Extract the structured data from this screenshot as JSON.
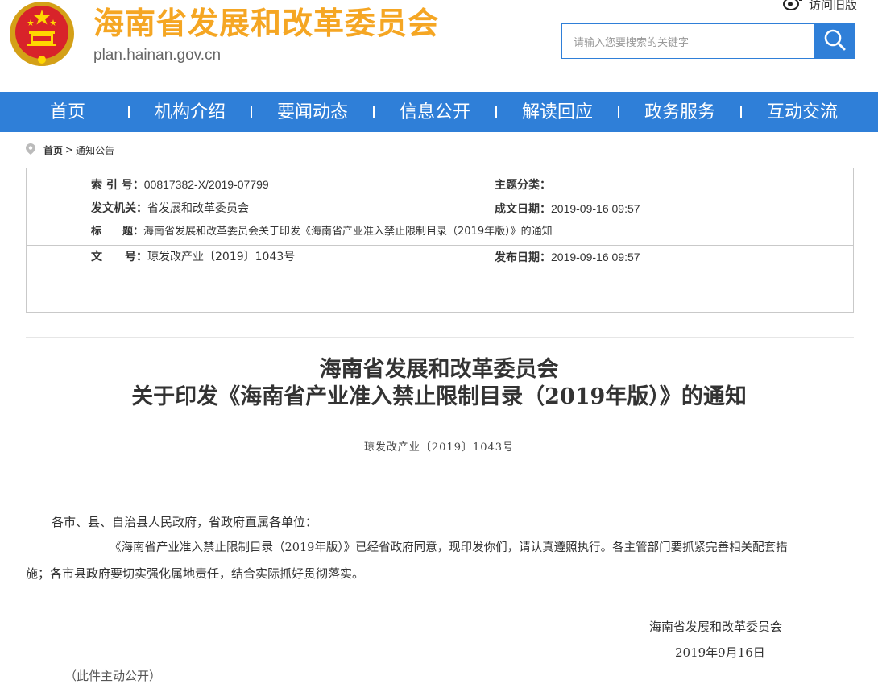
{
  "header": {
    "site_title": "海南省发展和改革委员会",
    "site_url": "plan.hainan.gov.cn",
    "old_version_label": "访问旧版",
    "search_placeholder": "请输入您要搜索的关键字"
  },
  "nav": {
    "items": [
      {
        "label": "首页"
      },
      {
        "label": "机构介绍"
      },
      {
        "label": "要闻动态"
      },
      {
        "label": "信息公开"
      },
      {
        "label": "解读回应"
      },
      {
        "label": "政务服务"
      },
      {
        "label": "互动交流"
      }
    ]
  },
  "breadcrumb": {
    "home": "首页",
    "separator": ">",
    "current": "通知公告"
  },
  "info": {
    "index_no_label": "索 引 号：",
    "index_no": "00817382-X/2019-07799",
    "topic_label": "主题分类：",
    "topic": "",
    "issuer_label": "发文机关：",
    "issuer": "省发展和改革委员会",
    "created_label": "成文日期：",
    "created": "2019-09-16 09:57",
    "title_label": "标　　题：",
    "title": "海南省发展和改革委员会关于印发《海南省产业准入禁止限制目录（2019年版）》的通知",
    "doc_no_label": "文　　号：",
    "doc_no": "琼发改产业〔2019〕1043号",
    "published_label": "发布日期：",
    "published": "2019-09-16 09:57"
  },
  "article": {
    "title_line1": "海南省发展和改革委员会",
    "title_line2": "关于印发《海南省产业准入禁止限制目录（2019年版）》的通知",
    "doc_no": "琼发改产业〔2019〕1043号",
    "salutation": "各市、县、自治县人民政府，省政府直属各单位：",
    "body_line1": "《海南省产业准入禁止限制目录（2019年版）》已经省政府同意，现印发你们，请认真遵照执行。各主管部门要抓紧完善相关配套措",
    "body_line2": "施；各市县政府要切实强化属地责任，结合实际抓好贯彻落实。",
    "signature_org": "海南省发展和改革委员会",
    "signature_date": "2019年9月16日",
    "footnote": "（此件主动公开）"
  },
  "colors": {
    "brand_blue": "#2f7fd8",
    "title_gold": "#f5a623"
  }
}
